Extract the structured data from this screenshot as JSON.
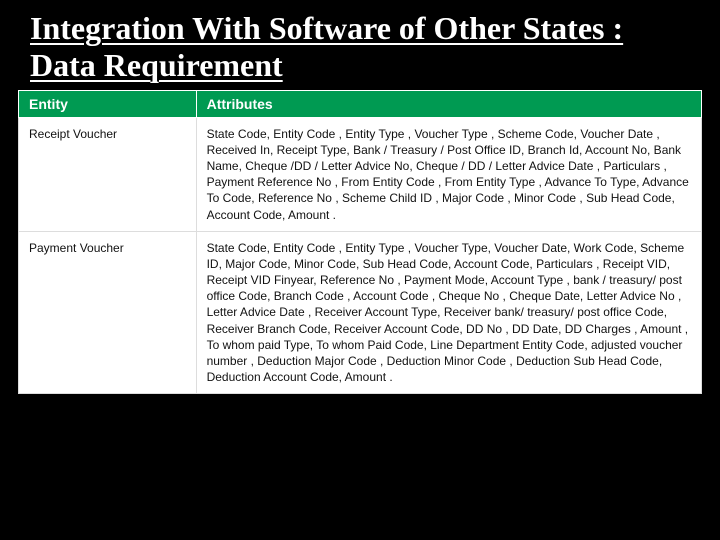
{
  "title": "Integration With Software of Other States : Data Requirement",
  "table": {
    "headers": [
      "Entity",
      "Attributes"
    ],
    "rows": [
      {
        "entity": "Receipt Voucher",
        "attributes": "State Code, Entity Code , Entity Type , Voucher Type , Scheme Code, Voucher Date , Received In, Receipt Type, Bank / Treasury / Post Office ID, Branch Id, Account No, Bank Name, Cheque /DD / Letter Advice No, Cheque / DD / Letter Advice Date , Particulars , Payment Reference No , From Entity Code , From Entity Type , Advance To Type, Advance To Code, Reference No , Scheme Child ID , Major Code , Minor Code , Sub Head Code, Account Code, Amount ."
      },
      {
        "entity": "Payment Voucher",
        "attributes": "State Code, Entity Code , Entity Type , Voucher Type, Voucher Date, Work Code, Scheme ID, Major Code, Minor Code, Sub Head Code, Account Code, Particulars , Receipt VID, Receipt VID Finyear, Reference No , Payment Mode, Account Type , bank / treasury/ post office Code, Branch Code , Account Code , Cheque No , Cheque Date, Letter Advice No , Letter Advice Date , Receiver Account Type, Receiver bank/ treasury/ post office Code, Receiver Branch Code, Receiver Account Code, DD No , DD Date, DD Charges , Amount , To whom paid Type, To whom Paid Code, Line Department Entity Code, adjusted voucher number , Deduction Major Code , Deduction Minor Code , Deduction Sub Head Code, Deduction Account Code, Amount ."
      }
    ]
  }
}
